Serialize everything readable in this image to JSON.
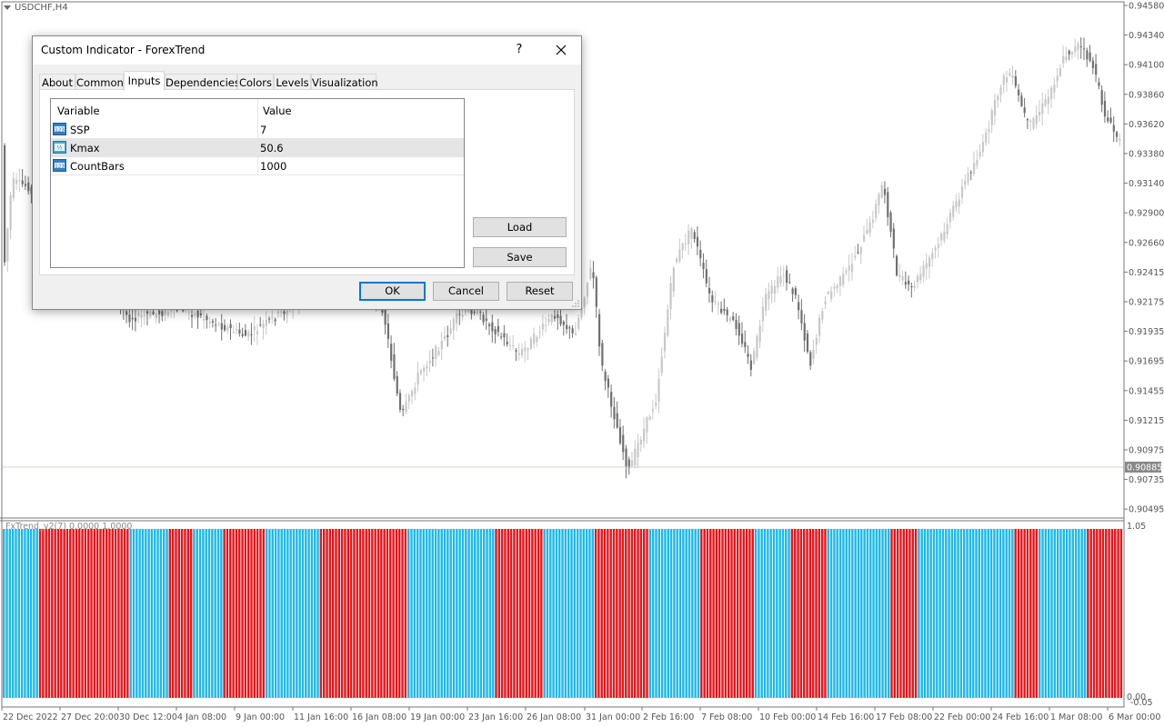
{
  "chart": {
    "symbol": "USDCHF,H4",
    "current_price": "0.90885",
    "price_levels": [
      "0.94580",
      "0.94340",
      "0.94100",
      "0.93860",
      "0.93620",
      "0.93380",
      "0.93140",
      "0.92900",
      "0.92660",
      "0.92415",
      "0.92175",
      "0.91935",
      "0.91695",
      "0.91455",
      "0.91215",
      "0.90975",
      "0.90735",
      "0.90495"
    ],
    "time_labels": [
      "22 Dec 2022",
      "27 Dec 20:00",
      "30 Dec 12:00",
      "4 Jan 08:00",
      "9 Jan 00:00",
      "11 Jan 16:00",
      "16 Jan 08:00",
      "19 Jan 00:00",
      "23 Jan 16:00",
      "26 Jan 08:00",
      "31 Jan 00:00",
      "2 Feb 16:00",
      "7 Feb 08:00",
      "10 Feb 00:00",
      "14 Feb 16:00",
      "17 Feb 08:00",
      "22 Feb 00:00",
      "24 Feb 16:00",
      "1 Mar 08:00",
      "6 Mar 00:00"
    ],
    "bull_color": "#c8c8c8",
    "bear_color": "#707070",
    "grid_color": "#e6e6e6"
  },
  "indicator": {
    "label": "FxTrend_v2(7) 0.0000 1.0000",
    "scale_top": "1.05",
    "scale_bottom": "0.00",
    "scale_bottom2": "-0.05",
    "up_color": "#1fb8e6",
    "down_color": "#e3161c",
    "segments": [
      {
        "trend": "up",
        "bars": 12
      },
      {
        "trend": "down",
        "bars": 30
      },
      {
        "trend": "up",
        "bars": 13
      },
      {
        "trend": "down",
        "bars": 8
      },
      {
        "trend": "up",
        "bars": 10
      },
      {
        "trend": "down",
        "bars": 14
      },
      {
        "trend": "up",
        "bars": 18
      },
      {
        "trend": "down",
        "bars": 29
      },
      {
        "trend": "up",
        "bars": 29
      },
      {
        "trend": "down",
        "bars": 16
      },
      {
        "trend": "up",
        "bars": 17
      },
      {
        "trend": "down",
        "bars": 18
      },
      {
        "trend": "up",
        "bars": 17
      },
      {
        "trend": "down",
        "bars": 18
      },
      {
        "trend": "up",
        "bars": 12
      },
      {
        "trend": "down",
        "bars": 12
      },
      {
        "trend": "up",
        "bars": 21
      },
      {
        "trend": "down",
        "bars": 9
      },
      {
        "trend": "up",
        "bars": 32
      },
      {
        "trend": "down",
        "bars": 8
      },
      {
        "trend": "up",
        "bars": 16
      },
      {
        "trend": "down",
        "bars": 12
      }
    ]
  },
  "dialog": {
    "title": "Custom Indicator - ForexTrend",
    "help": "?",
    "tabs": [
      "About",
      "Common",
      "Inputs",
      "Dependencies",
      "Colors",
      "Levels",
      "Visualization"
    ],
    "active_tab": "Inputs",
    "columns": [
      "Variable",
      "Value"
    ],
    "inputs": [
      {
        "variable": "SSP",
        "value": "7",
        "icon": "integer-icon"
      },
      {
        "variable": "Kmax",
        "value": "50.6",
        "icon": "double-icon"
      },
      {
        "variable": "CountBars",
        "value": "1000",
        "icon": "integer-icon"
      }
    ],
    "buttons": {
      "load": "Load",
      "save": "Save",
      "ok": "OK",
      "cancel": "Cancel",
      "reset": "Reset"
    }
  }
}
